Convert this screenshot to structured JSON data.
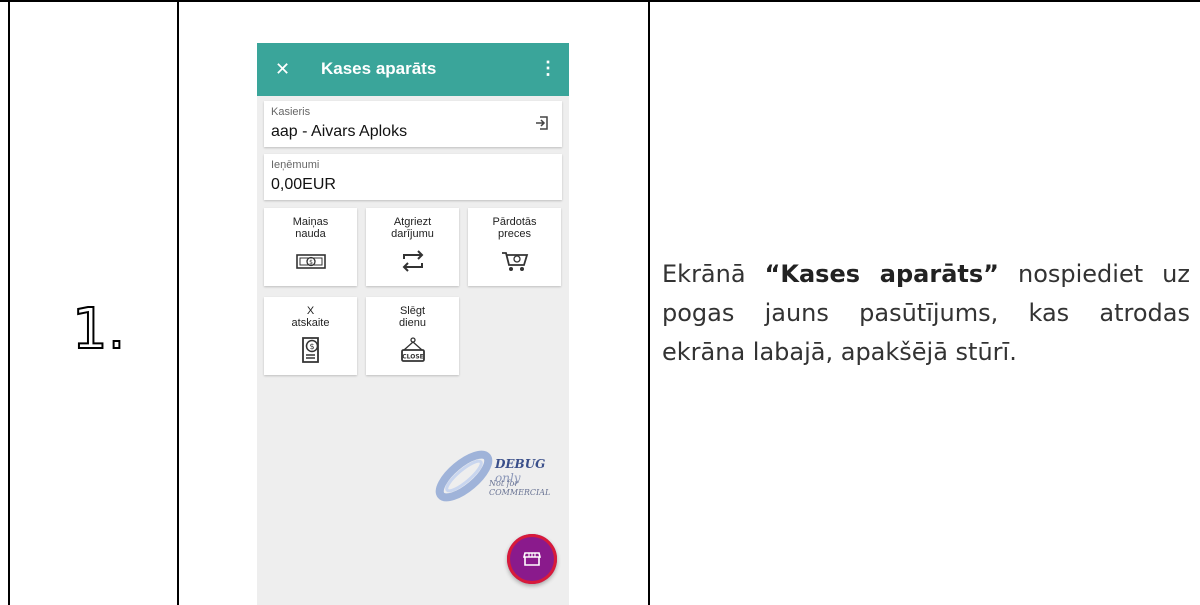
{
  "step": {
    "number": "1."
  },
  "instruction": {
    "prefix": "Ekrānā ",
    "bold": "“Kases aparāts”",
    "suffix": " nospiediet uz pogas jauns pasūtījums, kas atrodas ekrāna labajā, apakšējā stūrī."
  },
  "app": {
    "title": "Kases aparāts",
    "close_icon": "close-icon",
    "menu_icon": "more-vert-icon",
    "accent": "#3aa59a",
    "cashier": {
      "label": "Kasieris",
      "value": "aap - Aivars Aploks",
      "icon": "logout-icon"
    },
    "revenue": {
      "label": "Ieņēmumi",
      "value": "0,00EUR"
    },
    "tiles": [
      {
        "line1": "Maiņas",
        "line2": "nauda",
        "icon": "banknote-icon"
      },
      {
        "line1": "Atgriezt",
        "line2": "darījumu",
        "icon": "return-arrows-icon"
      },
      {
        "line1": "Pārdotās",
        "line2": "preces",
        "icon": "shopping-cart-icon"
      },
      {
        "line1": "X",
        "line2": "atskaite",
        "icon": "report-dollar-icon"
      },
      {
        "line1": "Slēgt",
        "line2": "dienu",
        "icon": "close-sign-icon"
      }
    ],
    "watermark": {
      "line1": "DEBUG",
      "line1_suffix": "only",
      "line2": "Not for COMMERCIAL"
    },
    "fab": {
      "icon": "storefront-icon",
      "color": "#8a1a8c"
    }
  }
}
